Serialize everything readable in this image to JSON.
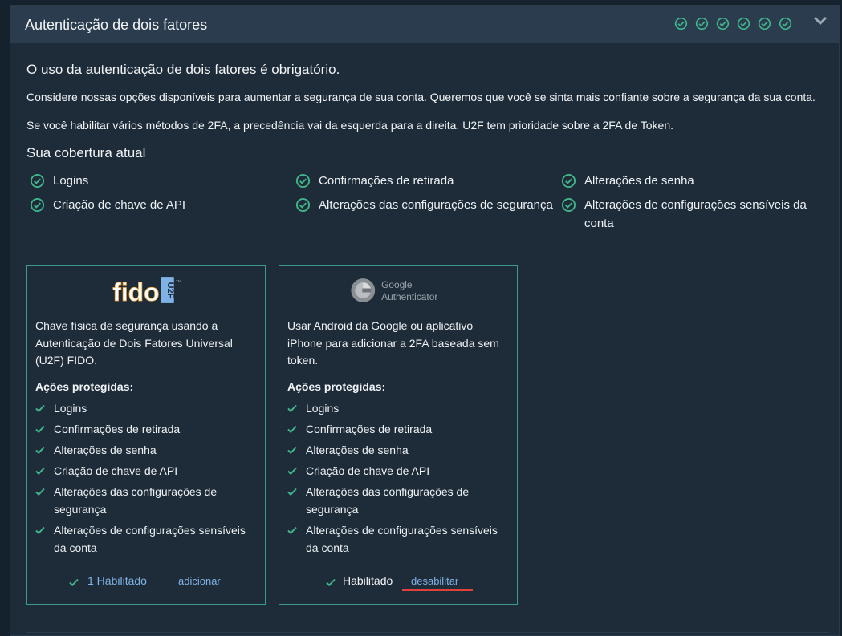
{
  "header": {
    "title": "Autenticação de dois fatores",
    "status_icon_count": 6
  },
  "intro": "O uso da autenticação de dois fatores é obrigatório.",
  "paragraph1": "Considere nossas opções disponíveis para aumentar a segurança de sua conta. Queremos que você se sinta mais confiante sobre a segurança da sua conta.",
  "paragraph2": "Se você habilitar vários métodos de 2FA, a precedência vai da esquerda para a direita. U2F tem prioridade sobre a 2FA de Token.",
  "coverage": {
    "title": "Sua cobertura atual",
    "items": [
      "Logins",
      "Confirmações de retirada",
      "Alterações de senha",
      "Criação de chave de API",
      "Alterações das configurações de segurança",
      "Alterações de configurações sensíveis da conta"
    ]
  },
  "cards": [
    {
      "logo": {
        "text": "fido",
        "badge": "U2F",
        "mark": "TM"
      },
      "description": "Chave física de segurança usando a Autenticação de Dois Fatores Universal (U2F) FIDO.",
      "actions_title": "Ações protegidas:",
      "actions": [
        "Logins",
        "Confirmações de retirada",
        "Alterações de senha",
        "Criação de chave de API",
        "Alterações das configurações de segurança",
        "Alterações de configurações sensíveis da conta"
      ],
      "status": "1 Habilitado",
      "action_link": "adicionar"
    },
    {
      "logo": {
        "line1": "Google",
        "line2": "Authenticator"
      },
      "description": "Usar Android da Google ou aplicativo iPhone para adicionar a 2FA baseada sem token.",
      "actions_title": "Ações protegidas:",
      "actions": [
        "Logins",
        "Confirmações de retirada",
        "Alterações de senha",
        "Criação de chave de API",
        "Alterações das configurações de segurança",
        "Alterações de configurações sensíveis da conta"
      ],
      "status": "Habilitado",
      "action_link": "desabilitar"
    }
  ],
  "colors": {
    "accent_green": "#3fb68b",
    "link_blue": "#7fb2e5",
    "card_border": "#3d9a8c",
    "underline_red": "#e0413a"
  }
}
